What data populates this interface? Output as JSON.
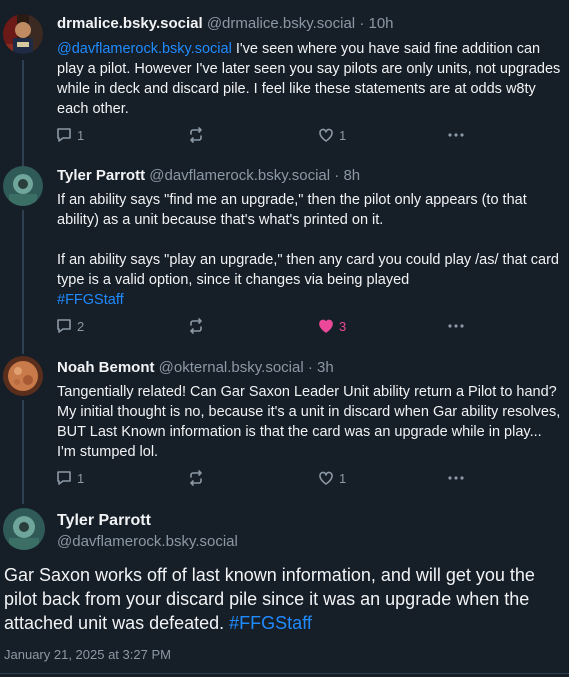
{
  "posts": [
    {
      "author": "drmalice.bsky.social",
      "handle": "@drmalice.bsky.social",
      "time": "· 10h",
      "mention": "@davflamerock.bsky.social",
      "text": " I've seen where you have said fine addition can play a pilot. However I've later seen you say pilots are only units, not upgrades while in deck and discard pile. I feel like these statements are at odds w8ty each other.",
      "reply_count": "1",
      "repost_count": "",
      "like_count": "1"
    },
    {
      "author": "Tyler Parrott",
      "handle": "@davflamerock.bsky.social",
      "time": "· 8h",
      "paragraph1": "If an ability says \"find me an upgrade,\" then the pilot only appears (to that ability) as a unit because that's what's printed on it.",
      "paragraph2": "If an ability says \"play an upgrade,\" then any card you could play /as/ that card type is a valid option, since it changes via being played",
      "hashtag": "#FFGStaff",
      "reply_count": "2",
      "repost_count": "",
      "like_count": "3"
    },
    {
      "author": "Noah Bemont",
      "handle": "@okternal.bsky.social",
      "time": "· 3h",
      "text": "Tangentially related! Can Gar Saxon Leader Unit ability return a Pilot to hand? My initial thought is no, because it's a unit in discard when Gar ability resolves, BUT Last Known information is that the card was an upgrade while in play... I'm stumped lol.",
      "reply_count": "1",
      "repost_count": "",
      "like_count": "1"
    }
  ],
  "main": {
    "author": "Tyler Parrott",
    "handle": "@davflamerock.bsky.social",
    "text": "Gar Saxon works off of last known information, and will get you the pilot back from your discard pile since it was an upgrade when the attached unit was defeated. ",
    "hashtag": "#FFGStaff",
    "timestamp": "January 21, 2025 at 3:27 PM"
  },
  "colors": {
    "background": "#161e27",
    "text": "#f1f3f5",
    "muted": "#8b98a5",
    "link": "#208bfe",
    "like_active": "#ec4899"
  },
  "icons": [
    "reply-icon",
    "repost-icon",
    "like-icon",
    "more-icon"
  ]
}
